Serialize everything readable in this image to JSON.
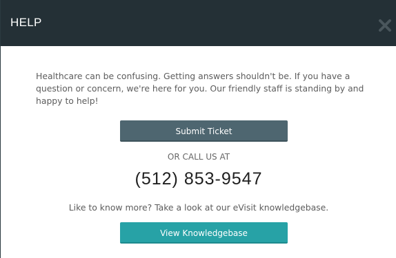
{
  "dialog": {
    "title": "HELP",
    "close_icon": "close-icon",
    "intro_text": "Healthcare can be confusing. Getting answers shouldn't be. If you have a question or concern, we're here for you. Our friendly staff is standing by and happy to help!",
    "submit_ticket_label": "Submit Ticket",
    "or_call_label": "OR CALL US AT",
    "phone_number": "(512) 853-9547",
    "knowledgebase_text": "Like to know more? Take a look at our eVisit knowledgebase.",
    "view_knowledgebase_label": "View Knowledgebase"
  },
  "colors": {
    "header_bg": "#243036",
    "submit_button": "#4e6670",
    "knowledgebase_button": "#27a2a6"
  }
}
